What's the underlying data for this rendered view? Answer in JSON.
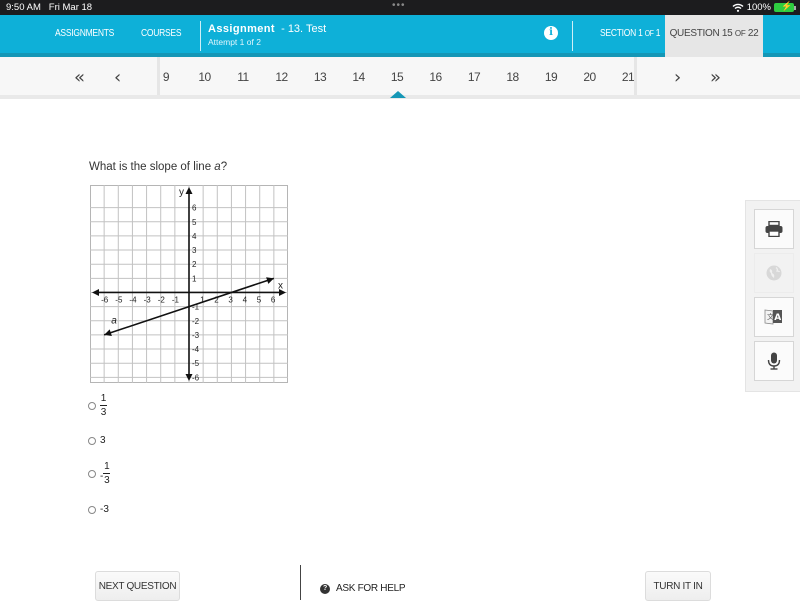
{
  "status_bar": {
    "time": "9:50 AM",
    "date": "Fri Mar 18",
    "dots": "•••",
    "battery_percent": "100%",
    "wifi_icon": "wifi-icon",
    "battery_icon": "battery-charging-icon"
  },
  "top_nav": {
    "assignments_label": "ASSIGNMENTS",
    "courses_label": "COURSES",
    "assignment_title": "Assignment",
    "assignment_name": "- 13. Test",
    "attempt": "Attempt 1 of 2",
    "info_icon": "info-icon",
    "section_main": "SECTION 1 ",
    "section_of": "OF",
    "section_total": " 1",
    "question_main": "QUESTION 15 ",
    "question_of": "OF",
    "question_total": " 22",
    "accent_color": "#0eb0d8"
  },
  "pager": {
    "first_icon": "double-chevron-left-icon",
    "prev_icon": "chevron-left-icon",
    "next_icon": "chevron-right-icon",
    "last_icon": "double-chevron-right-icon",
    "numbers": [
      "9",
      "10",
      "11",
      "12",
      "13",
      "14",
      "15",
      "16",
      "17",
      "18",
      "19",
      "20",
      "21"
    ],
    "current": "15"
  },
  "question": {
    "text_prefix": "What is the slope of line ",
    "text_var": "a",
    "text_suffix": "?"
  },
  "graph": {
    "x_label": "x",
    "y_label": "y",
    "line_label": "a",
    "range": [
      -6,
      6
    ],
    "x_ticks": [
      "-6",
      "-5",
      "-4",
      "-3",
      "-2",
      "-1",
      "1",
      "2",
      "3",
      "4",
      "5",
      "6"
    ],
    "y_ticks_pos": [
      "1",
      "2",
      "3",
      "4",
      "5",
      "6"
    ],
    "y_ticks_neg": [
      "-1",
      "-2",
      "-3",
      "-4",
      "-5",
      "-6"
    ],
    "line_points": [
      [
        -6,
        -3
      ],
      [
        6,
        1
      ]
    ]
  },
  "choices": [
    {
      "type": "fraction",
      "sign": "",
      "numerator": "1",
      "denominator": "3"
    },
    {
      "type": "plain",
      "text": "3"
    },
    {
      "type": "fraction",
      "sign": "-",
      "numerator": "1",
      "denominator": "3"
    },
    {
      "type": "plain",
      "text": "-3"
    }
  ],
  "tools": [
    {
      "name": "print",
      "icon": "printer-icon",
      "enabled": true
    },
    {
      "name": "globe",
      "icon": "globe-icon",
      "enabled": false
    },
    {
      "name": "translate",
      "icon": "translate-icon",
      "enabled": true
    },
    {
      "name": "microphone",
      "icon": "microphone-icon",
      "enabled": true
    }
  ],
  "footer": {
    "next_question": "NEXT QUESTION",
    "ask_for_help": "ASK FOR HELP",
    "help_icon_glyph": "?",
    "turn_it_in": "TURN IT IN"
  }
}
